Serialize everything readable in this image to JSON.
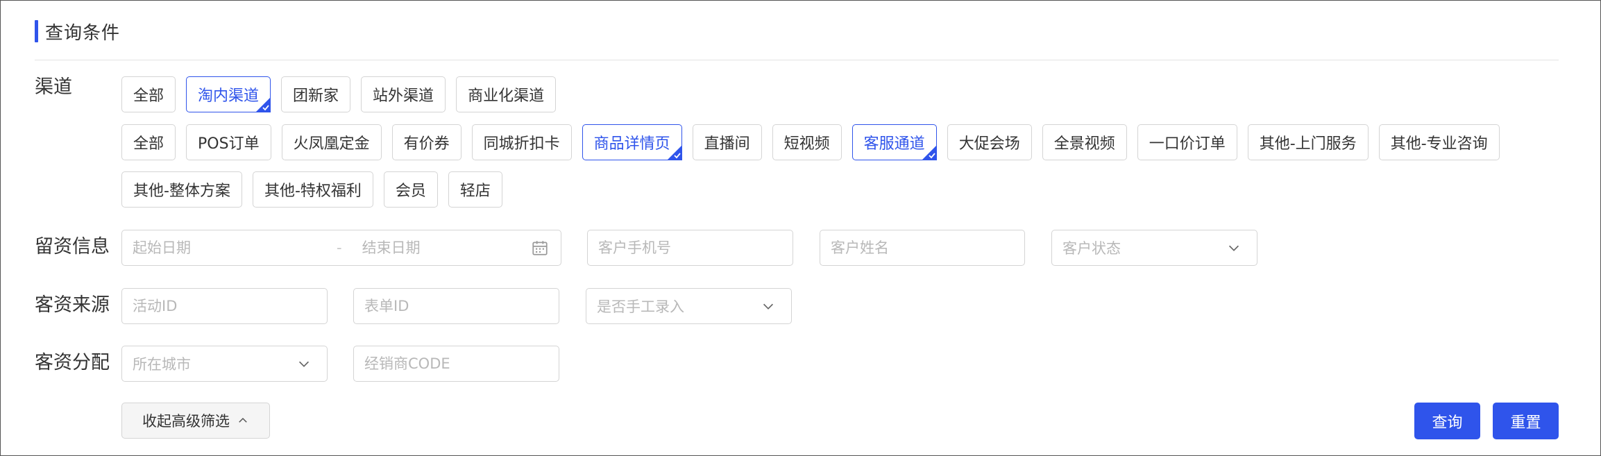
{
  "panel": {
    "title": "查询条件"
  },
  "labels": {
    "channel": "渠道",
    "lead_info": "留资信息",
    "source": "客资来源",
    "allocation": "客资分配"
  },
  "channel_primary": [
    {
      "label": "全部",
      "selected": false
    },
    {
      "label": "淘内渠道",
      "selected": true
    },
    {
      "label": "团新家",
      "selected": false
    },
    {
      "label": "站外渠道",
      "selected": false
    },
    {
      "label": "商业化渠道",
      "selected": false
    }
  ],
  "channel_secondary_row1": [
    {
      "label": "全部",
      "selected": false
    },
    {
      "label": "POS订单",
      "selected": false
    },
    {
      "label": "火凤凰定金",
      "selected": false
    },
    {
      "label": "有价券",
      "selected": false
    },
    {
      "label": "同城折扣卡",
      "selected": false
    },
    {
      "label": "商品详情页",
      "selected": true
    },
    {
      "label": "直播间",
      "selected": false
    },
    {
      "label": "短视频",
      "selected": false
    },
    {
      "label": "客服通道",
      "selected": true
    },
    {
      "label": "大促会场",
      "selected": false
    },
    {
      "label": "全景视频",
      "selected": false
    },
    {
      "label": "一口价订单",
      "selected": false
    },
    {
      "label": "其他-上门服务",
      "selected": false
    },
    {
      "label": "其他-专业咨询",
      "selected": false
    }
  ],
  "channel_secondary_row2": [
    {
      "label": "其他-整体方案",
      "selected": false
    },
    {
      "label": "其他-特权福利",
      "selected": false
    },
    {
      "label": "会员",
      "selected": false
    },
    {
      "label": "轻店",
      "selected": false
    }
  ],
  "lead_info": {
    "start_date_placeholder": "起始日期",
    "range_separator": "-",
    "end_date_placeholder": "结束日期",
    "phone_placeholder": "客户手机号",
    "name_placeholder": "客户姓名",
    "status_placeholder": "客户状态"
  },
  "source": {
    "activity_id_placeholder": "活动ID",
    "form_id_placeholder": "表单ID",
    "manual_entry_placeholder": "是否手工录入"
  },
  "allocation": {
    "city_placeholder": "所在城市",
    "dealer_code_placeholder": "经销商CODE"
  },
  "actions": {
    "collapse_label": "收起高级筛选",
    "search_label": "查询",
    "reset_label": "重置"
  },
  "colors": {
    "accent": "#2f54eb",
    "border": "#d4d4d4",
    "placeholder": "#b8b8b8"
  },
  "icons": {
    "calendar": "calendar-icon",
    "chevron_down": "chevron-down-icon",
    "chevron_up": "chevron-up-icon",
    "selected_mark": "check-corner-icon"
  }
}
